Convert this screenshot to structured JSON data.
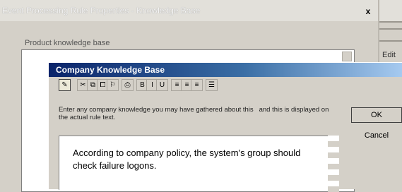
{
  "outer_dialog": {
    "title": "Event Processing Rule Properties - Knowledge Base",
    "close_glyph": "x",
    "subtitle": "Product knowledge base",
    "side_button": "Edit"
  },
  "kb_dialog": {
    "title": "Company Knowledge Base",
    "toolbar": {
      "buttons": [
        {
          "name": "draft-icon",
          "glyph": "✎"
        },
        {
          "name": "cut-icon",
          "glyph": "✂"
        },
        {
          "name": "copy-icon",
          "glyph": "⧉"
        },
        {
          "name": "paste-icon",
          "glyph": "⧠"
        },
        {
          "name": "find-icon",
          "glyph": "⚐"
        },
        {
          "name": "print-icon",
          "glyph": "⎙"
        },
        {
          "name": "bold-icon",
          "glyph": "B"
        },
        {
          "name": "italic-icon",
          "glyph": "I"
        },
        {
          "name": "underline-icon",
          "glyph": "U"
        },
        {
          "name": "align-left-icon",
          "glyph": "≡"
        },
        {
          "name": "align-center-icon",
          "glyph": "≡"
        },
        {
          "name": "align-right-icon",
          "glyph": "≡"
        },
        {
          "name": "bullets-icon",
          "glyph": "☰"
        }
      ]
    },
    "instructions": "Enter any company knowledge you may have gathered about this   and this is displayed on the actual rule text.",
    "ok_label": "OK",
    "cancel_label": "Cancel",
    "text_content": "According to company policy, the system's group should check failure logons."
  }
}
